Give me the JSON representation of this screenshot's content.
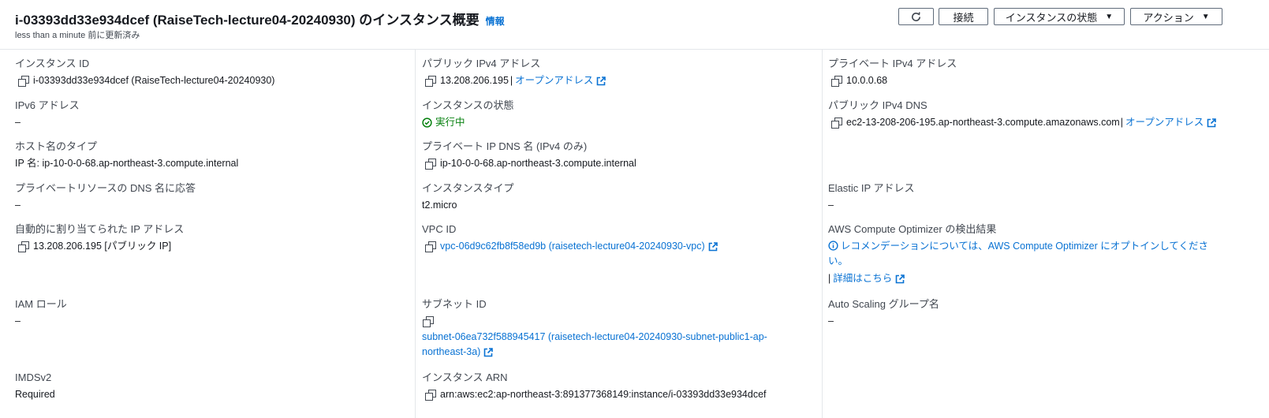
{
  "header": {
    "title": "i-03393dd33e934dcef (RaiseTech-lecture04-20240930) のインスタンス概要",
    "info_link": "情報",
    "subtitle": "less than a minute 前に更新済み",
    "buttons": {
      "connect": "接続",
      "instance_state": "インスタンスの状態",
      "actions": "アクション"
    }
  },
  "col1": {
    "instance_id": {
      "label": "インスタンス ID",
      "value": "i-03393dd33e934dcef (RaiseTech-lecture04-20240930)"
    },
    "ipv6": {
      "label": "IPv6 アドレス",
      "value": "–"
    },
    "hostname_type": {
      "label": "ホスト名のタイプ",
      "value": "IP 名: ip-10-0-0-68.ap-northeast-3.compute.internal"
    },
    "private_dns_answer": {
      "label": "プライベートリソースの DNS 名に応答",
      "value": "–"
    },
    "auto_ip": {
      "label": "自動的に割り当てられた IP アドレス",
      "value": "13.208.206.195 [パブリック IP]"
    },
    "iam_role": {
      "label": "IAM ロール",
      "value": "–"
    },
    "imdsv2": {
      "label": "IMDSv2",
      "value": "Required"
    }
  },
  "col2": {
    "public_ipv4": {
      "label": "パブリック IPv4 アドレス",
      "value": "13.208.206.195",
      "sep": "|",
      "link": "オープンアドレス"
    },
    "state": {
      "label": "インスタンスの状態",
      "value": "実行中"
    },
    "private_ip_dns": {
      "label": "プライベート IP DNS 名 (IPv4 のみ)",
      "value": "ip-10-0-0-68.ap-northeast-3.compute.internal"
    },
    "instance_type": {
      "label": "インスタンスタイプ",
      "value": "t2.micro"
    },
    "vpc_id": {
      "label": "VPC ID",
      "link": "vpc-06d9c62fb8f58ed9b (raisetech-lecture04-20240930-vpc)"
    },
    "subnet_id": {
      "label": "サブネット ID",
      "link_line1": "subnet-06ea732f588945417 (raisetech-lecture04-20240930-subnet-public1-ap-",
      "link_line2": "northeast-3a)"
    },
    "arn": {
      "label": "インスタンス ARN",
      "value": "arn:aws:ec2:ap-northeast-3:891377368149:instance/i-03393dd33e934dcef"
    }
  },
  "col3": {
    "private_ipv4": {
      "label": "プライベート IPv4 アドレス",
      "value": "10.0.0.68"
    },
    "public_dns": {
      "label": "パブリック IPv4 DNS",
      "value": "ec2-13-208-206-195.ap-northeast-3.compute.amazonaws.com",
      "sep": "|",
      "link": "オープンアドレス"
    },
    "elastic_ip": {
      "label": "Elastic IP アドレス",
      "value": "–"
    },
    "optimizer": {
      "label": "AWS Compute Optimizer の検出結果",
      "link_line1": "レコメンデーションについては、AWS Compute Optimizer にオプトインしてくださ",
      "link_line2": "い。",
      "sep": "|",
      "more_link": "詳細はこちら"
    },
    "asg": {
      "label": "Auto Scaling グループ名",
      "value": "–"
    }
  },
  "colors": {
    "link": "#0972d3",
    "success": "#037f0c",
    "label": "#414750",
    "text": "#16191f"
  },
  "icons": [
    "refresh-icon",
    "copy-icon",
    "external-link-icon",
    "status-running-icon",
    "info-circle-icon",
    "caret-down-icon"
  ]
}
